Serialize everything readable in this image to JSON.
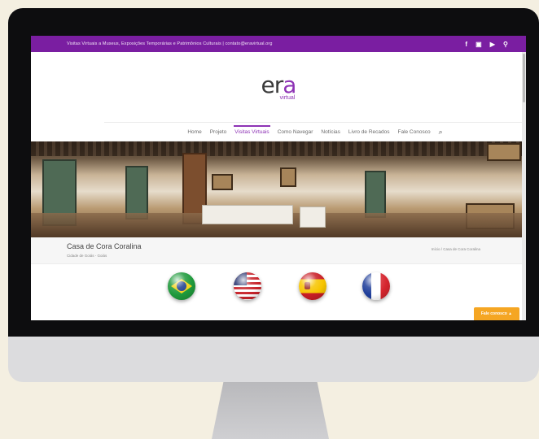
{
  "topbar": {
    "text": "Visitas Virtuais a Museus, Exposições Temporárias e Patrimônios Culturais  |  contato@eravirtual.org",
    "socials": [
      "f",
      "▣",
      "▶",
      "⚲"
    ]
  },
  "logo": {
    "main_a": "er",
    "main_b": "a",
    "sub": "virtual"
  },
  "nav": {
    "items": [
      "Home",
      "Projeto",
      "Visitas Virtuais",
      "Como Navegar",
      "Notícias",
      "Livro de Recados",
      "Fale Conosco"
    ],
    "active_index": 2,
    "search_icon": "⌕"
  },
  "page": {
    "title": "Casa de Cora Coralina",
    "subtitle": "Cidade de Goiás - Goiás",
    "breadcrumb": "Início / Casa de Cora Coralina"
  },
  "flags": {
    "brazil": "brazil-flag",
    "usa": "usa-flag",
    "spain": "spain-flag",
    "france": "france-flag"
  },
  "chat": {
    "label": "Fale conosco ▲"
  },
  "colors": {
    "brand": "#7a1ea1",
    "accent": "#8e33b5",
    "chat": "#f5a623"
  }
}
